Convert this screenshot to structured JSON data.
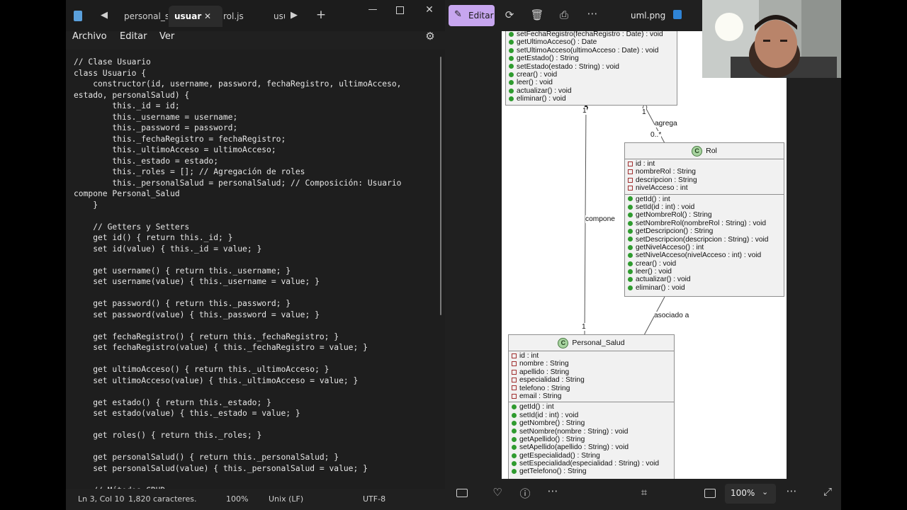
{
  "notepad": {
    "tabs": [
      "personal_sal",
      "usuar",
      "rol.js",
      "usu"
    ],
    "menu": [
      "Archivo",
      "Editar",
      "Ver"
    ],
    "code": "// Clase Usuario\nclass Usuario {\n    constructor(id, username, password, fechaRegistro, ultimoAcceso,\nestado, personalSalud) {\n        this._id = id;\n        this._username = username;\n        this._password = password;\n        this._fechaRegistro = fechaRegistro;\n        this._ultimoAcceso = ultimoAcceso;\n        this._estado = estado;\n        this._roles = []; // Agregación de roles\n        this._personalSalud = personalSalud; // Composición: Usuario\ncompone Personal_Salud\n    }\n\n    // Getters y Setters\n    get id() { return this._id; }\n    set id(value) { this._id = value; }\n\n    get username() { return this._username; }\n    set username(value) { this._username = value; }\n\n    get password() { return this._password; }\n    set password(value) { this._password = value; }\n\n    get fechaRegistro() { return this._fechaRegistro; }\n    set fechaRegistro(value) { this._fechaRegistro = value; }\n\n    get ultimoAcceso() { return this._ultimoAcceso; }\n    set ultimoAcceso(value) { this._ultimoAcceso = value; }\n\n    get estado() { return this._estado; }\n    set estado(value) { this._estado = value; }\n\n    get roles() { return this._roles; }\n\n    get personalSalud() { return this._personalSalud; }\n    set personalSalud(value) { this._personalSalud = value; }\n\n    // Métodos CRUD",
    "status": {
      "position": "Ln 3, Col 10",
      "chars": "1,820 caracteres.",
      "zoom": "100%",
      "eol": "Unix (LF)",
      "encoding": "UTF-8"
    }
  },
  "photos": {
    "edit_label": "Editar",
    "file_name": "uml.png",
    "zoom": "100%"
  },
  "uml": {
    "usuario_methods": [
      "setFechaRegistro(fechaRegistro : Date) : void",
      "getUltimoAcceso() : Date",
      "setUltimoAcceso(ultimoAcceso : Date) : void",
      "getEstado() : String",
      "setEstado(estado : String) : void",
      "crear() : void",
      "leer() : void",
      "actualizar() : void",
      "eliminar() : void"
    ],
    "rol": {
      "name": "Rol",
      "attributes": [
        "id : int",
        "nombreRol : String",
        "descripcion : String",
        "nivelAcceso : int"
      ],
      "methods": [
        "getId() : int",
        "setId(id : int) : void",
        "getNombreRol() : String",
        "setNombreRol(nombreRol : String) : void",
        "getDescripcion() : String",
        "setDescripcion(descripcion : String) : void",
        "getNivelAcceso() : int",
        "setNivelAcceso(nivelAcceso : int) : void",
        "crear() : void",
        "leer() : void",
        "actualizar() : void",
        "eliminar() : void"
      ]
    },
    "personal": {
      "name": "Personal_Salud",
      "attributes": [
        "id : int",
        "nombre : String",
        "apellido : String",
        "especialidad : String",
        "telefono : String",
        "email : String"
      ],
      "methods": [
        "getId() : int",
        "setId(id : int) : void",
        "getNombre() : String",
        "setNombre(nombre : String) : void",
        "getApellido() : String",
        "setApellido(apellido : String) : void",
        "getEspecialidad() : String",
        "setEspecialidad(especialidad : String) : void",
        "getTelefono() : String"
      ]
    },
    "labels": {
      "agrega": "agrega",
      "compone": "compone",
      "asociado": "asociado a",
      "mult_one": "1",
      "mult_many": "0..*"
    },
    "class_badge": "C"
  },
  "colors": {
    "edit_accent": "#c7a6ef",
    "class_badge": "#a8d4a0",
    "public_marker": "#2f9b2f",
    "private_marker": "#a13030"
  }
}
